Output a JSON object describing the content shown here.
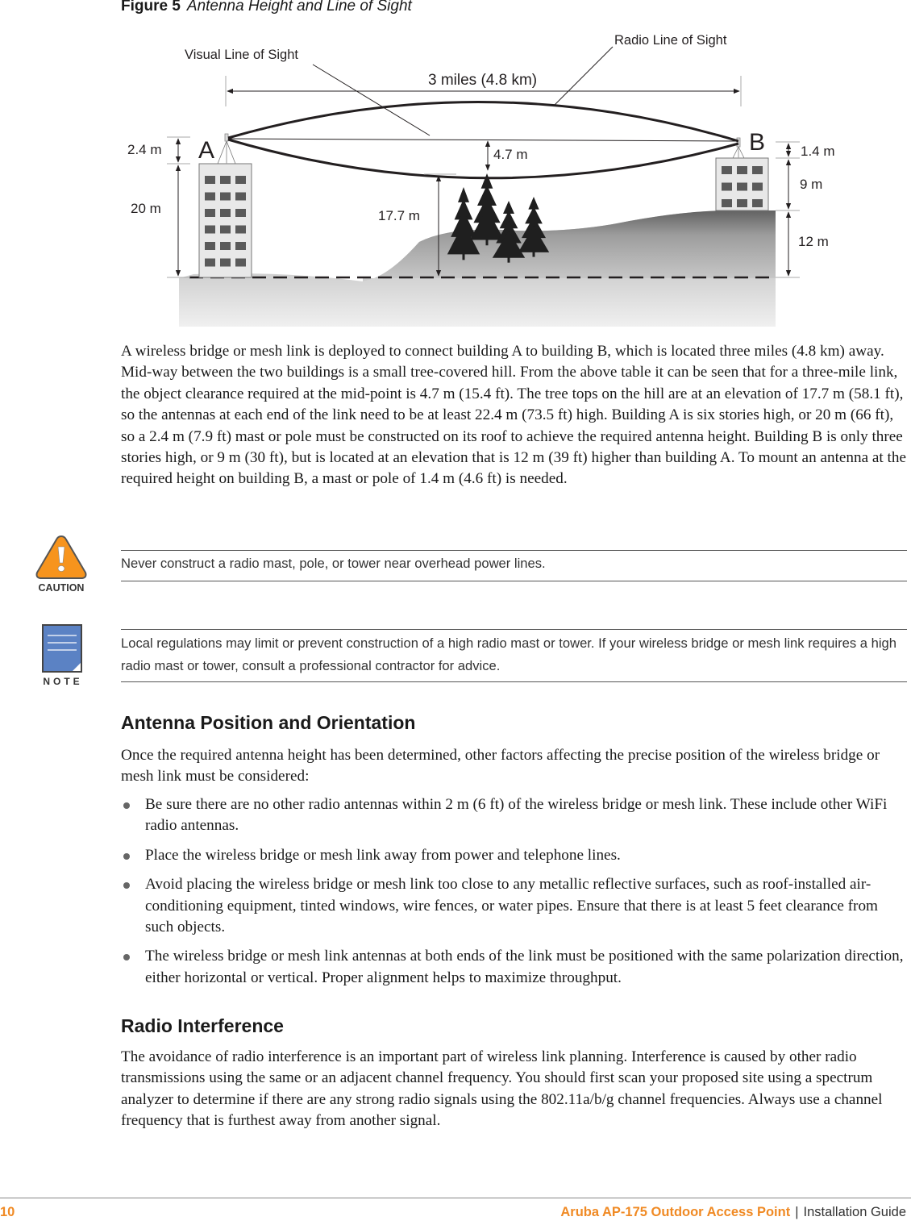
{
  "figure": {
    "number_label": "Figure 5",
    "title": "Antenna Height and Line of Sight",
    "labels": {
      "visual_los": "Visual Line of Sight",
      "radio_los": "Radio Line of Sight",
      "distance": "3 miles (4.8 km)",
      "building_a": "A",
      "building_b": "B",
      "mast_a": "2.4 m",
      "building_a_height": "20 m",
      "tree_height": "17.7 m",
      "clearance": "4.7 m",
      "mast_b": "1.4 m",
      "building_b_height": "9 m",
      "hill_elevation": "12 m"
    },
    "building_a_stories": 6,
    "building_b_stories": 3
  },
  "paragraphs": {
    "intro": "A wireless bridge or mesh link is deployed to connect building A to building B, which is located three miles (4.8 km) away. Mid-way between the two buildings is a small tree-covered hill. From the above table it can be seen that for a three-mile link, the object clearance required at the mid-point is 4.7 m (15.4 ft). The tree tops on the hill are at an elevation of 17.7 m (58.1 ft), so the antennas at each end of the link need to be at least 22.4 m (73.5 ft) high. Building A is six stories high, or 20 m (66 ft), so a 2.4 m (7.9 ft) mast or pole must be constructed on its roof to achieve the required antenna height. Building B is only three stories high, or 9 m (30 ft), but is located at an elevation that is 12 m (39 ft) higher than building A. To mount an antenna at the required height on building B, a mast or pole of 1.4 m (4.6 ft) is needed."
  },
  "caution": {
    "icon_label": "CAUTION",
    "text": "Never construct a radio mast, pole, or tower near overhead power lines.",
    "color": "#f7941d"
  },
  "note": {
    "icon_label": "NOTE",
    "text": "Local regulations may limit or prevent construction of a high radio mast or tower. If your wireless bridge or mesh link requires a high radio mast or tower, consult a professional contractor for advice.",
    "color": "#5b82c4"
  },
  "sections": [
    {
      "heading": "Antenna Position and Orientation",
      "intro": "Once the required antenna height has been determined, other factors affecting the precise position of the wireless bridge or mesh link must be considered:",
      "bullets": [
        "Be sure there are no other radio antennas within 2 m (6 ft) of the wireless bridge or mesh link. These include other WiFi radio antennas.",
        "Place the wireless bridge or mesh link away from power and telephone lines.",
        "Avoid placing the wireless bridge or mesh link too close to any metallic reflective surfaces, such as roof-installed air-conditioning equipment, tinted windows, wire fences, or water pipes. Ensure that there is at least 5 feet clearance from such objects.",
        "The wireless bridge or mesh link antennas at both ends of the link must be positioned with the same polarization direction, either horizontal or vertical. Proper alignment helps to maximize throughput."
      ]
    },
    {
      "heading": "Radio Interference",
      "intro": "The avoidance of radio interference is an important part of wireless link planning. Interference is caused by other radio transmissions using the same or an adjacent channel frequency. You should first scan your proposed site using a spectrum analyzer to determine if there are any strong radio signals using the 802.11a/b/g channel frequencies. Always use a channel frequency that is furthest away from another signal."
    }
  ],
  "footer": {
    "page_number": "10",
    "product": "Aruba AP-175 Outdoor Access Point",
    "separator": "|",
    "doc_type": "Installation Guide",
    "accent_color": "#f08a24"
  }
}
